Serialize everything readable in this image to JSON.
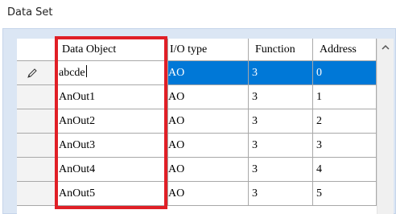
{
  "section": {
    "title": "Data Set"
  },
  "table": {
    "columns": [
      "",
      "Data Object",
      "I/O type",
      "Function",
      "Address"
    ],
    "rows": [
      {
        "editing": true,
        "data_object": "abcde",
        "io_type": "AO",
        "function": "3",
        "address": "0"
      },
      {
        "data_object": "AnOut1",
        "io_type": "AO",
        "function": "3",
        "address": "1"
      },
      {
        "data_object": "AnOut2",
        "io_type": "AO",
        "function": "3",
        "address": "2"
      },
      {
        "data_object": "AnOut3",
        "io_type": "AO",
        "function": "3",
        "address": "3"
      },
      {
        "data_object": "AnOut4",
        "io_type": "AO",
        "function": "3",
        "address": "4"
      },
      {
        "data_object": "AnOut5",
        "io_type": "AO",
        "function": "3",
        "address": "5"
      }
    ]
  },
  "colors": {
    "selection": "#0078d7",
    "highlight_border": "#e01f26",
    "panel": "#dbe6f4"
  },
  "icons": {
    "row_edit": "pencil-icon",
    "scroll_up": "chevron-up-icon"
  }
}
